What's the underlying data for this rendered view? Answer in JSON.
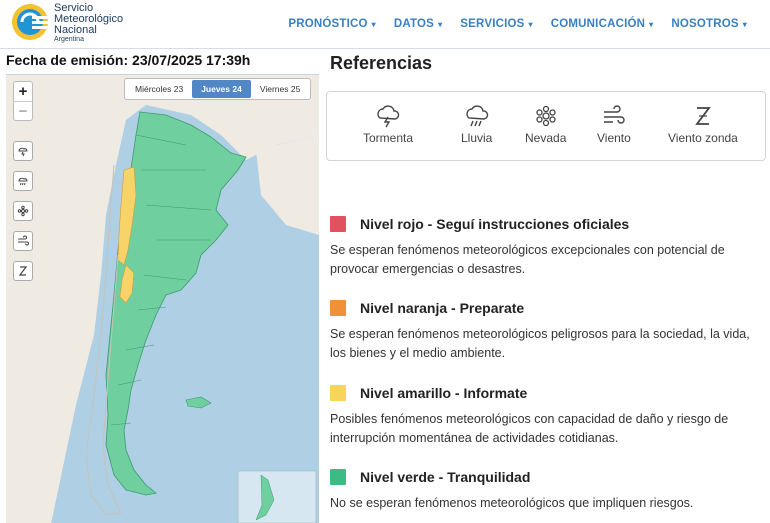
{
  "header": {
    "brand_line1": "Servicio",
    "brand_line2": "Meteorológico",
    "brand_line3": "Nacional",
    "brand_line4": "Argentina",
    "nav": [
      {
        "label": "PRONÓSTICO",
        "caret": "▾"
      },
      {
        "label": "DATOS",
        "caret": "▾"
      },
      {
        "label": "SERVICIOS",
        "caret": "▾"
      },
      {
        "label": "COMUNICACIÓN",
        "caret": "▾"
      },
      {
        "label": "NOSOTROS",
        "caret": "▾"
      }
    ]
  },
  "left": {
    "emission": "Fecha de emisión: 23/07/2025 17:39h",
    "zoom_in": "+",
    "zoom_out": "−",
    "days": [
      {
        "label": "Miércoles 23",
        "active": false
      },
      {
        "label": "Jueves 24",
        "active": true
      },
      {
        "label": "Viernes 25",
        "active": false
      }
    ],
    "map_buttons": [
      "storm-icon",
      "rain-icon",
      "snow-icon",
      "wind-icon",
      "zonda-icon"
    ]
  },
  "right": {
    "title": "Referencias",
    "refs": [
      {
        "label": "Tormenta",
        "icon": "storm-icon"
      },
      {
        "label": "Lluvia",
        "icon": "rain-icon"
      },
      {
        "label": "Nevada",
        "icon": "snow-icon"
      },
      {
        "label": "Viento",
        "icon": "wind-icon"
      },
      {
        "label": "Viento zonda",
        "icon": "zonda-icon"
      }
    ],
    "levels": [
      {
        "title": "Nivel rojo - Seguí instrucciones oficiales",
        "desc": "Se esperan fenómenos meteorológicos excepcionales con potencial de provocar emergencias o desastres.",
        "color": "#e05260"
      },
      {
        "title": "Nivel naranja - Preparate",
        "desc": "Se esperan fenómenos meteorológicos peligrosos para la sociedad, la vida, los bienes y el medio ambiente.",
        "color": "#f0913a"
      },
      {
        "title": "Nivel amarillo - Informate",
        "desc": "Posibles fenómenos meteorológicos con capacidad de daño y riesgo de interrupción momentánea de actividades cotidianas.",
        "color": "#f9d45c"
      },
      {
        "title": "Nivel verde - Tranquilidad",
        "desc": "No se esperan fenómenos meteorológicos que impliquen riesgos.",
        "color": "#3dbb87"
      }
    ]
  },
  "colors": {
    "accent": "#3a7fc1",
    "active_tab": "#5087c4",
    "green_zone": "#6fcf9f",
    "yellow_zone": "#f7d36a",
    "sea": "#aecfe4",
    "land": "#f1ede6"
  }
}
